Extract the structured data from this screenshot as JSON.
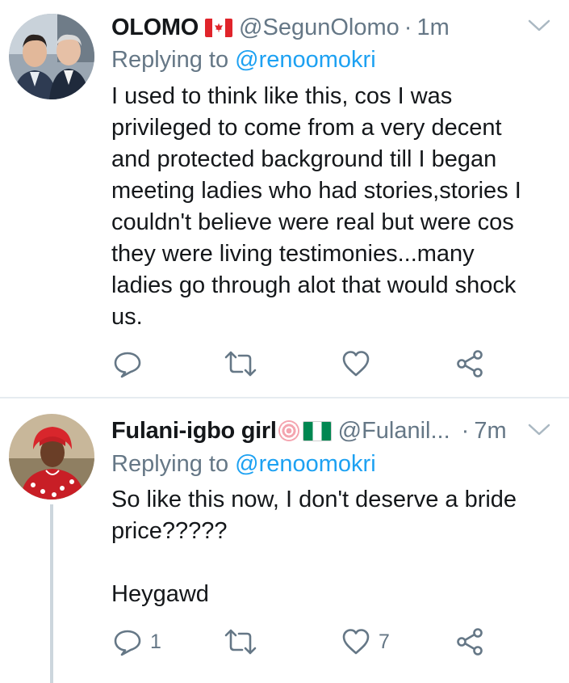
{
  "colors": {
    "text": "#14171a",
    "secondary": "#657786",
    "link": "#1da1f2",
    "divider": "#e6ecf0",
    "thread_line": "#ccd6dd"
  },
  "tweets": [
    {
      "display_name": "OLOMO",
      "name_emoji": [
        "flag-canada"
      ],
      "handle": "@SegunOlomo",
      "separator": "·",
      "time": "1m",
      "replying_prefix": "Replying to ",
      "replying_mention": "@renoomokri",
      "text": "I used to think like this, cos I was\nprivileged to come from a very decent\nand protected background till I began\nmeeting ladies who had stories,stories I\ncouldn't believe were real but were cos\nthey were living testimonies...many\nladies go through alot that would shock\nus.",
      "actions": {
        "reply_count": "",
        "retweet_count": "",
        "like_count": ""
      },
      "icons": [
        "reply-icon",
        "retweet-icon",
        "heart-icon",
        "share-icon",
        "chevron-down-icon"
      ]
    },
    {
      "display_name": "Fulani-igbo girl",
      "name_emoji": [
        "fish-cake-swirl",
        "flag-nigeria"
      ],
      "handle": "@Fulanil...",
      "separator": "·",
      "time": "7m",
      "replying_prefix": "Replying to ",
      "replying_mention": "@renoomokri",
      "text": "So like this now, I don't deserve a bride\nprice?????\n\nHeygawd",
      "actions": {
        "reply_count": "1",
        "retweet_count": "",
        "like_count": "7"
      },
      "icons": [
        "reply-icon",
        "retweet-icon",
        "heart-icon",
        "share-icon",
        "chevron-down-icon"
      ]
    }
  ]
}
